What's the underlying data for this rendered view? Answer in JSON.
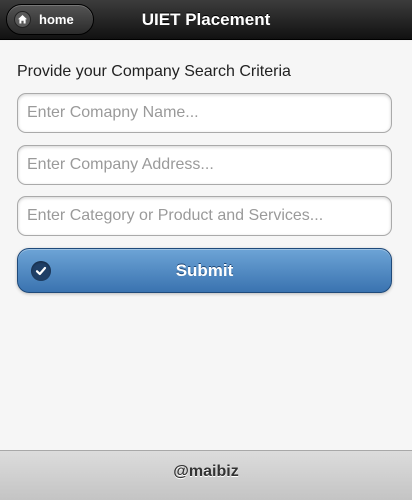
{
  "header": {
    "title": "UIET Placement",
    "home_label": "home"
  },
  "form": {
    "heading": "Provide your Company Search Criteria",
    "company_name_placeholder": "Enter Comapny Name...",
    "company_address_placeholder": "Enter Company Address...",
    "category_placeholder": "Enter Category or Product and Services...",
    "submit_label": "Submit"
  },
  "footer": {
    "text": "@maibiz"
  },
  "icons": {
    "home": "home-icon",
    "submit": "checkmark-icon"
  },
  "colors": {
    "header_bg": "#1a1a1a",
    "submit_bg": "#4a86c5",
    "footer_bg": "#d0d0d0"
  }
}
